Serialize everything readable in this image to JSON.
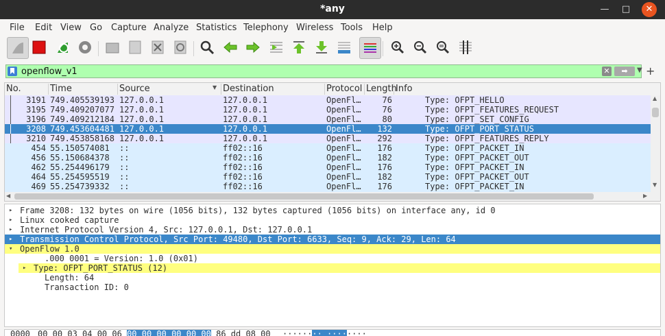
{
  "window": {
    "title": "*any"
  },
  "menu": [
    "File",
    "Edit",
    "View",
    "Go",
    "Capture",
    "Analyze",
    "Statistics",
    "Telephony",
    "Wireless",
    "Tools",
    "Help"
  ],
  "toolbar": [
    "start-capture-icon",
    "stop-capture-icon",
    "restart-capture-icon",
    "capture-options-icon",
    "open-file-icon",
    "save-file-icon",
    "close-file-icon",
    "reload-file-icon",
    "find-packet-icon",
    "go-back-icon",
    "go-forward-icon",
    "go-to-packet-icon",
    "go-first-icon",
    "go-last-icon",
    "autoscroll-icon",
    "colorize-icon",
    "zoom-in-icon",
    "zoom-out-icon",
    "zoom-reset-icon",
    "resize-columns-icon"
  ],
  "filter": {
    "value": "openflow_v1"
  },
  "columns": [
    "No.",
    "Time",
    "Source",
    "Destination",
    "Protocol",
    "Length",
    "Info"
  ],
  "packets": [
    {
      "no": "3191",
      "time": "749.405539193",
      "src": "127.0.0.1",
      "dst": "127.0.0.1",
      "proto": "OpenFl…",
      "len": "76",
      "info": "Type: OFPT_HELLO"
    },
    {
      "no": "3195",
      "time": "749.409207077",
      "src": "127.0.0.1",
      "dst": "127.0.0.1",
      "proto": "OpenFl…",
      "len": "76",
      "info": "Type: OFPT_FEATURES_REQUEST"
    },
    {
      "no": "3196",
      "time": "749.409212184",
      "src": "127.0.0.1",
      "dst": "127.0.0.1",
      "proto": "OpenFl…",
      "len": "80",
      "info": "Type: OFPT_SET_CONFIG"
    },
    {
      "no": "3208",
      "time": "749.453604481",
      "src": "127.0.0.1",
      "dst": "127.0.0.1",
      "proto": "OpenFl…",
      "len": "132",
      "info": "Type: OFPT_PORT_STATUS"
    },
    {
      "no": "3210",
      "time": "749.453858168",
      "src": "127.0.0.1",
      "dst": "127.0.0.1",
      "proto": "OpenFl…",
      "len": "292",
      "info": "Type: OFPT_FEATURES_REPLY"
    },
    {
      "no": "454",
      "time": "55.150574081",
      "src": "::",
      "dst": "ff02::16",
      "proto": "OpenFl…",
      "len": "176",
      "info": "Type: OFPT_PACKET_IN"
    },
    {
      "no": "456",
      "time": "55.150684378",
      "src": "::",
      "dst": "ff02::16",
      "proto": "OpenFl…",
      "len": "182",
      "info": "Type: OFPT_PACKET_OUT"
    },
    {
      "no": "462",
      "time": "55.254496179",
      "src": "::",
      "dst": "ff02::16",
      "proto": "OpenFl…",
      "len": "176",
      "info": "Type: OFPT_PACKET_IN"
    },
    {
      "no": "464",
      "time": "55.254595519",
      "src": "::",
      "dst": "ff02::16",
      "proto": "OpenFl…",
      "len": "182",
      "info": "Type: OFPT_PACKET_OUT"
    },
    {
      "no": "469",
      "time": "55.254739332",
      "src": "::",
      "dst": "ff02::16",
      "proto": "OpenFl…",
      "len": "176",
      "info": "Type: OFPT_PACKET_IN"
    }
  ],
  "details": [
    {
      "text": "Frame 3208: 132 bytes on wire (1056 bits), 132 bytes captured (1056 bits) on interface any, id 0",
      "state": "collapsed",
      "indent": 0
    },
    {
      "text": "Linux cooked capture",
      "state": "collapsed",
      "indent": 0
    },
    {
      "text": "Internet Protocol Version 4, Src: 127.0.0.1, Dst: 127.0.0.1",
      "state": "collapsed",
      "indent": 0
    },
    {
      "text": "Transmission Control Protocol, Src Port: 49480, Dst Port: 6633, Seq: 9, Ack: 29, Len: 64",
      "state": "collapsed",
      "indent": 0
    },
    {
      "text": "OpenFlow 1.0",
      "state": "expanded",
      "indent": 0
    },
    {
      "text": ".000 0001 = Version: 1.0 (0x01)",
      "state": "none",
      "indent": 1
    },
    {
      "text": "Type: OFPT_PORT_STATUS (12)",
      "state": "collapsed",
      "indent": 1
    },
    {
      "text": "Length: 64",
      "state": "none",
      "indent": 1
    },
    {
      "text": "Transaction ID: 0",
      "state": "none",
      "indent": 1
    }
  ],
  "hex": {
    "offset": "0000",
    "bytes_a": "00 00 03 04 00 06",
    "bytes_sel": "00 00  00 00 00 00",
    "bytes_b": "86 dd 08 00",
    "ascii_a": "······",
    "ascii_sel": "·· ····",
    "ascii_b": "····"
  }
}
